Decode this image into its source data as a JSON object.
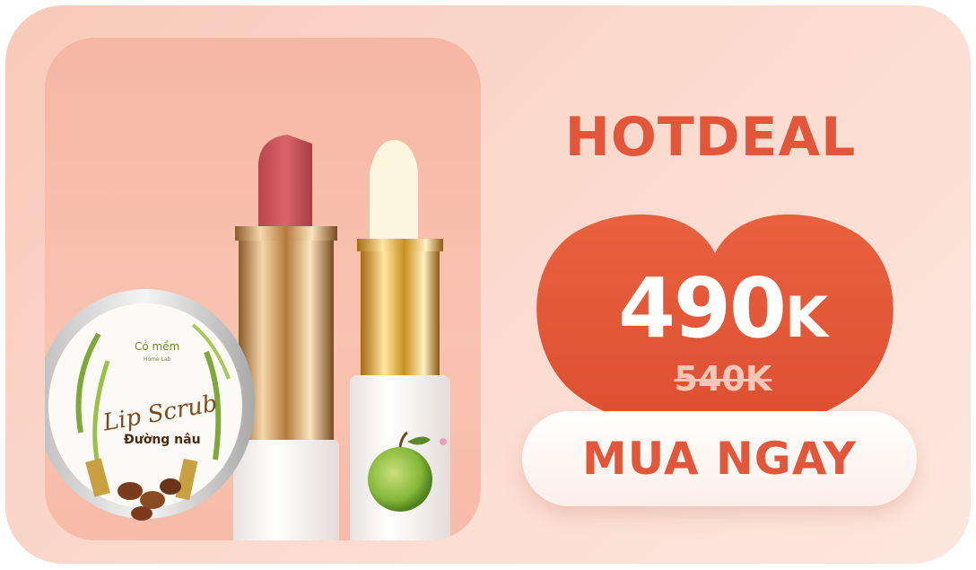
{
  "banner": {
    "headline": "HOTDEAL",
    "price": "490",
    "price_unit": "K",
    "old_price": "540K",
    "cta_label": "MUA NGAY"
  },
  "product_image": {
    "brand": "Cỏ mềm",
    "brand_sub": "Home Lab",
    "jar_script": "Lip Scrub",
    "jar_label": "Đường nâu"
  },
  "colors": {
    "accent": "#e2573a",
    "heart": "#e35a37",
    "background": "#fbd9cd",
    "old_price": "#f6c6b6"
  }
}
